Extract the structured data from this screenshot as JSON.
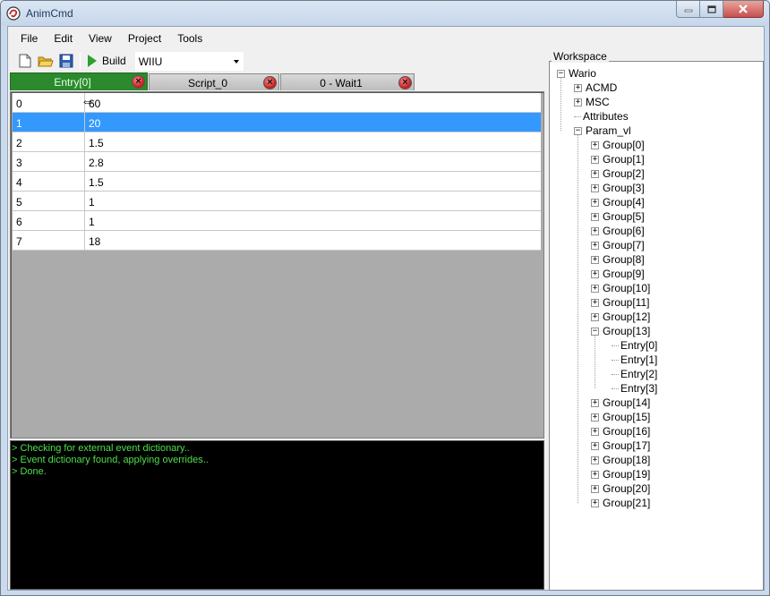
{
  "window": {
    "title": "AnimCmd"
  },
  "menu": [
    "File",
    "Edit",
    "View",
    "Project",
    "Tools"
  ],
  "toolbar": {
    "new_icon": "new-file-icon",
    "open_icon": "open-folder-icon",
    "save_icon": "save-icon",
    "build_label": "Build",
    "platform": "WIIU"
  },
  "tabs": [
    {
      "label": "Entry[0]",
      "active": true
    },
    {
      "label": "Script_0",
      "active": false
    },
    {
      "label": "0 - Wait1",
      "active": false
    }
  ],
  "grid": {
    "selected_row": 1,
    "rows": [
      [
        "0",
        "60"
      ],
      [
        "1",
        "20"
      ],
      [
        "2",
        "1.5"
      ],
      [
        "3",
        "2.8"
      ],
      [
        "4",
        "1.5"
      ],
      [
        "5",
        "1"
      ],
      [
        "6",
        "1"
      ],
      [
        "7",
        "18"
      ]
    ]
  },
  "console": [
    "> Checking for external event dictionary..",
    "> Event dictionary found, applying overrides..",
    "> Done."
  ],
  "workspace": {
    "label": "Workspace",
    "root": "Wario",
    "children": [
      "ACMD",
      "MSC",
      "Attributes",
      "Param_vl"
    ],
    "groups": [
      "Group[0]",
      "Group[1]",
      "Group[2]",
      "Group[3]",
      "Group[4]",
      "Group[5]",
      "Group[6]",
      "Group[7]",
      "Group[8]",
      "Group[9]",
      "Group[10]",
      "Group[11]",
      "Group[12]",
      "Group[13]",
      "Group[14]",
      "Group[15]",
      "Group[16]",
      "Group[17]",
      "Group[18]",
      "Group[19]",
      "Group[20]",
      "Group[21]"
    ],
    "group13_entries": [
      "Entry[0]",
      "Entry[1]",
      "Entry[2]",
      "Entry[3]"
    ]
  },
  "colors": {
    "active_tab": "#2b8a2b",
    "selection": "#3399ff",
    "console_text": "#4de04d"
  }
}
